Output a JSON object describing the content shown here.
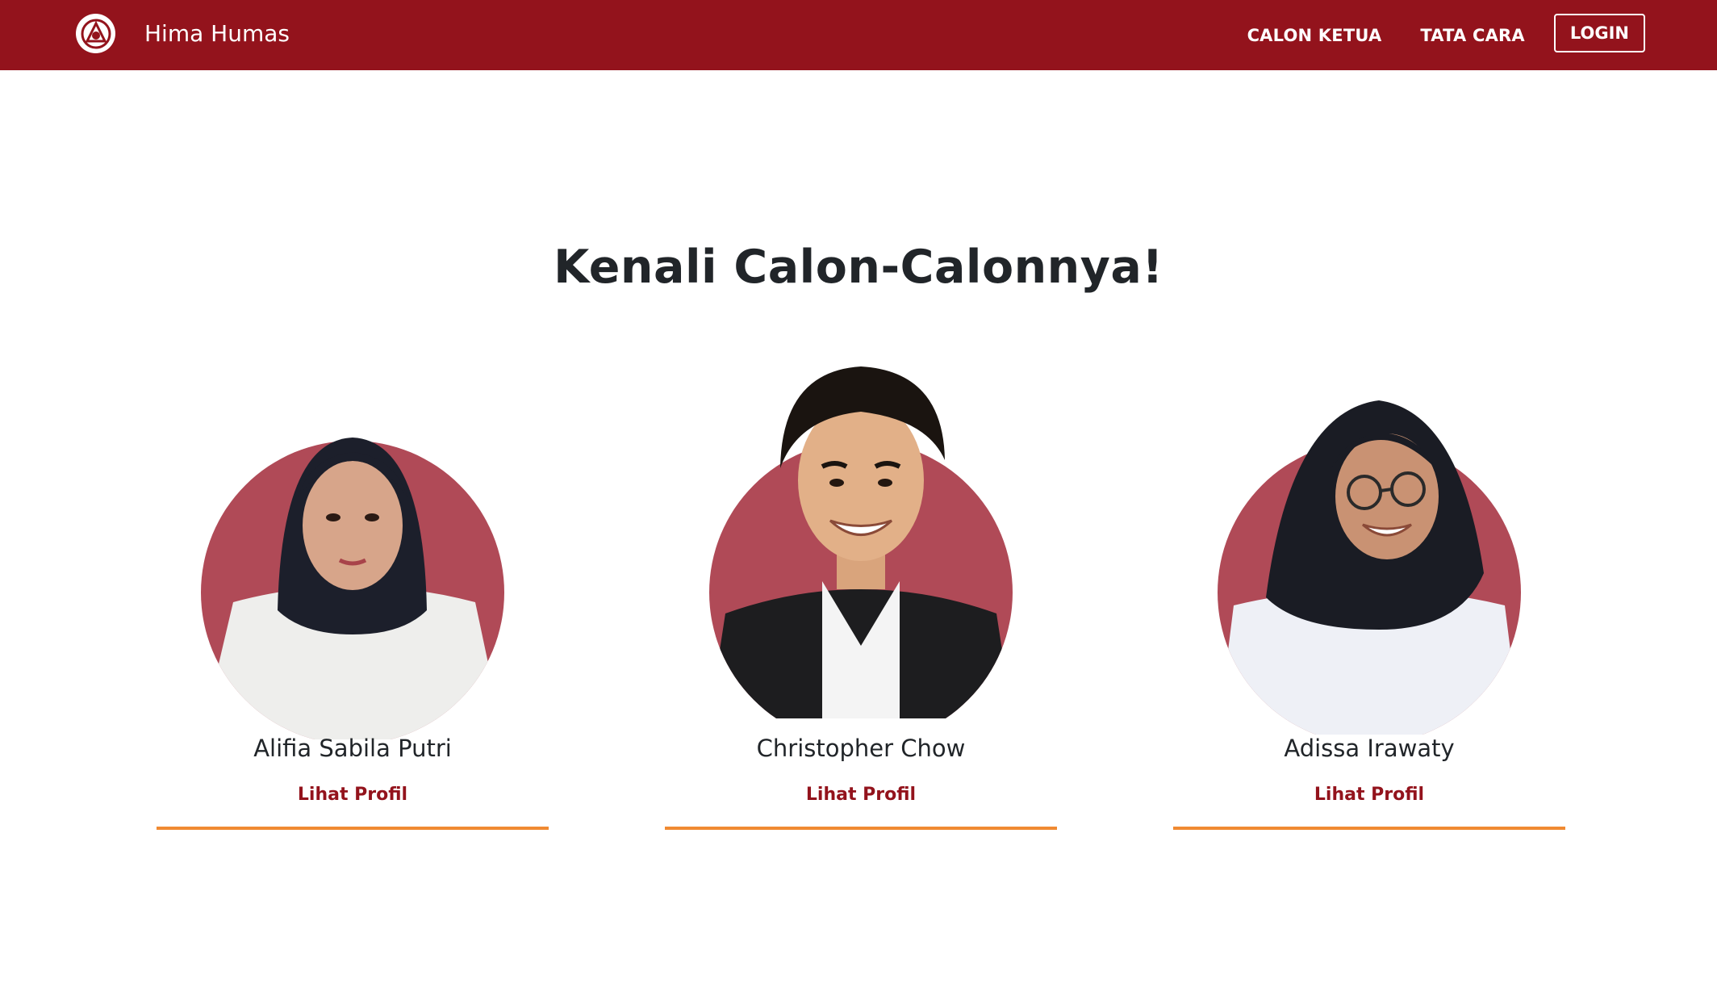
{
  "navbar": {
    "brand_name": "Hima Humas",
    "links": [
      {
        "label": "CALON KETUA"
      },
      {
        "label": "TATA CARA"
      }
    ],
    "login_label": "LOGIN",
    "background": "#93131c"
  },
  "main": {
    "heading": "Kenali Calon-Calonnya!"
  },
  "candidates": [
    {
      "name": "Alifia Sabila Putri",
      "link": "Lihat Profil"
    },
    {
      "name": "Christopher Chow",
      "link": "Lihat Profil"
    },
    {
      "name": "Adissa Irawaty",
      "link": "Lihat Profil"
    }
  ],
  "colors": {
    "brand": "#93131c",
    "photo_circle": "#b04a57",
    "accent_line": "#f08a32"
  }
}
